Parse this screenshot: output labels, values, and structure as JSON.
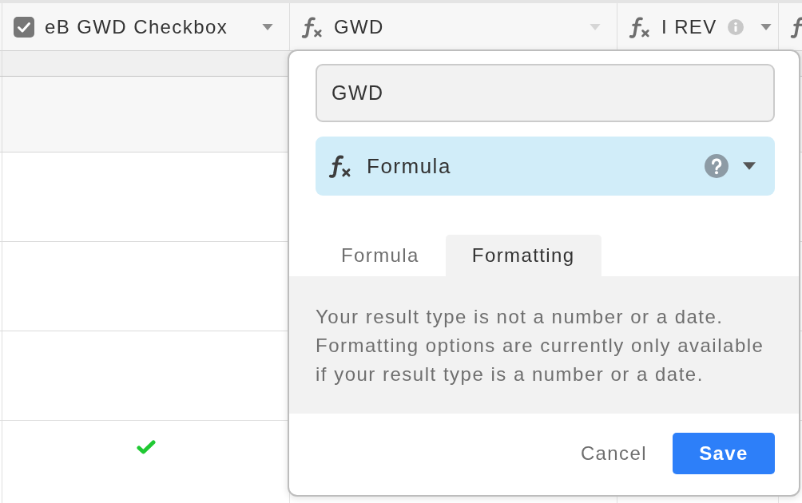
{
  "table": {
    "columns": [
      {
        "kind": "checkbox",
        "label": "eB GWD Checkbox",
        "info": false,
        "editing": false
      },
      {
        "kind": "formula",
        "label": "GWD",
        "info": false,
        "editing": true
      },
      {
        "kind": "formula",
        "label": "I REV",
        "info": true,
        "editing": false
      },
      {
        "kind": "formula"
      }
    ],
    "rows": [
      {
        "checked": false
      },
      {
        "checked": false
      },
      {
        "checked": false
      },
      {
        "checked": true
      }
    ]
  },
  "field_editor": {
    "name": "GWD",
    "type": {
      "kind": "formula",
      "label": "Formula"
    },
    "tabs": [
      {
        "label": "Formula",
        "selected": false
      },
      {
        "label": "Formatting",
        "selected": true
      }
    ],
    "message": "Your result type is not a number or a date. Formatting options are currently only available if your result type is a number or a date.",
    "buttons": [
      {
        "kind": "cancel",
        "label": "Cancel"
      },
      {
        "kind": "save",
        "label": "Save"
      }
    ]
  }
}
